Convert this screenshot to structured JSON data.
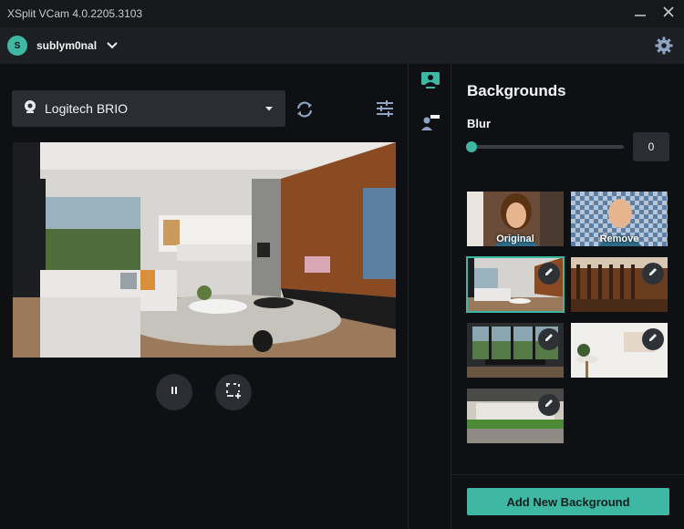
{
  "window": {
    "title": "XSplit VCam 4.0.2205.3103"
  },
  "user": {
    "initial": "S",
    "name": "sublym0nal"
  },
  "camera": {
    "selected": "Logitech BRIO"
  },
  "panel": {
    "heading": "Backgrounds",
    "blur_label": "Blur",
    "blur_value": "0",
    "blur_level": 0
  },
  "thumbnails": [
    {
      "label": "Original",
      "selected": false,
      "editable": false
    },
    {
      "label": "Remove",
      "selected": false,
      "editable": false
    },
    {
      "label": "",
      "selected": true,
      "editable": true
    },
    {
      "label": "",
      "selected": false,
      "editable": true
    },
    {
      "label": "",
      "selected": false,
      "editable": true
    },
    {
      "label": "",
      "selected": false,
      "editable": true
    },
    {
      "label": "",
      "selected": false,
      "editable": true
    }
  ],
  "add_button": "Add New Background",
  "colors": {
    "accent": "#3fb8a3",
    "panel": "#2a2d33",
    "background": "#0e1014"
  },
  "icons": {
    "minimize": "minimize-icon",
    "close": "close-icon",
    "settings": "gear-icon",
    "webcam": "webcam-icon",
    "refresh": "refresh-icon",
    "adjust": "sliders-icon",
    "pause": "pause-icon",
    "crop": "crop-icon",
    "edit": "pencil-icon"
  }
}
